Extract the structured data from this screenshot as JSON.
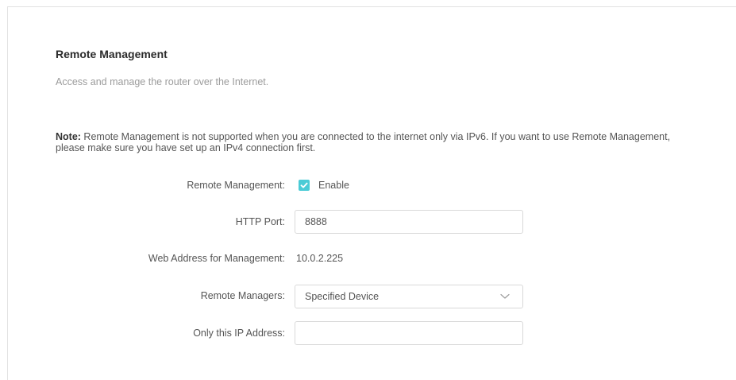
{
  "section": {
    "title": "Remote Management",
    "subtitle": "Access and manage the router over the Internet."
  },
  "note": {
    "label": "Note:",
    "text": " Remote Management is not supported when you are connected to the internet only via IPv6. If you want to use Remote Management, please make sure you have set up an IPv4 connection first."
  },
  "form": {
    "remote_management": {
      "label": "Remote Management:",
      "checkbox_label": "Enable",
      "checked": true
    },
    "http_port": {
      "label": "HTTP Port:",
      "value": "8888"
    },
    "web_address": {
      "label": "Web Address for Management:",
      "value": "10.0.2.225"
    },
    "remote_managers": {
      "label": "Remote Managers:",
      "selected": "Specified Device"
    },
    "only_ip": {
      "label": "Only this IP Address:",
      "value": ""
    }
  },
  "colors": {
    "accent": "#4acbd6",
    "border": "#d9d9d9",
    "muted_text": "#9b9b9b"
  },
  "icons": {
    "checkbox": "check-icon",
    "dropdown": "chevron-down-icon"
  }
}
